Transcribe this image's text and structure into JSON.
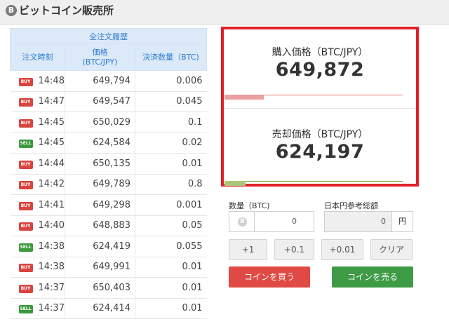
{
  "header": {
    "icon": "bitcoin-icon",
    "icon_glyph": "B",
    "title": "ビットコイン販売所"
  },
  "orders_table": {
    "title": "全注文履歴",
    "columns": [
      "注文時刻",
      "価格\n(BTC/JPY)",
      "決済数量（BTC)"
    ],
    "rows": [
      {
        "type": "BUY",
        "time": "14:48",
        "price": "649,794",
        "amount": "0.006"
      },
      {
        "type": "BUY",
        "time": "14:47",
        "price": "649,547",
        "amount": "0.045"
      },
      {
        "type": "BUY",
        "time": "14:45",
        "price": "650,029",
        "amount": "0.1"
      },
      {
        "type": "SELL",
        "time": "14:45",
        "price": "624,584",
        "amount": "0.02"
      },
      {
        "type": "BUY",
        "time": "14:44",
        "price": "650,135",
        "amount": "0.01"
      },
      {
        "type": "BUY",
        "time": "14:42",
        "price": "649,789",
        "amount": "0.8"
      },
      {
        "type": "BUY",
        "time": "14:41",
        "price": "649,298",
        "amount": "0.001"
      },
      {
        "type": "BUY",
        "time": "14:40",
        "price": "648,883",
        "amount": "0.05"
      },
      {
        "type": "SELL",
        "time": "14:38",
        "price": "624,419",
        "amount": "0.055"
      },
      {
        "type": "BUY",
        "time": "14:38",
        "price": "649,991",
        "amount": "0.01"
      },
      {
        "type": "BUY",
        "time": "14:37",
        "price": "650,403",
        "amount": "0.01"
      },
      {
        "type": "SELL",
        "time": "14:37",
        "price": "624,414",
        "amount": "0.01"
      }
    ]
  },
  "buy_price": {
    "label": "購入価格（BTC/JPY）",
    "value": "649,872",
    "bar_fraction": 0.22,
    "color": "#e07070"
  },
  "sell_price": {
    "label": "売却価格（BTC/JPY）",
    "value": "624,197",
    "bar_fraction": 0.12,
    "color": "#6a9e3c"
  },
  "highlight_color": "#e0212a",
  "quantity": {
    "label": "数量（BTC)",
    "value": "0",
    "icon": "bitcoin-icon",
    "icon_glyph": "B"
  },
  "jpy_total": {
    "label": "日本円参考総額",
    "value": "0",
    "unit": "円"
  },
  "step_buttons": [
    "+1",
    "+0.1",
    "+0.01",
    "クリア"
  ],
  "buy_button": {
    "label": "コインを買う",
    "color": "#e04a45"
  },
  "sell_button": {
    "label": "コインを売る",
    "color": "#3e9b45"
  }
}
